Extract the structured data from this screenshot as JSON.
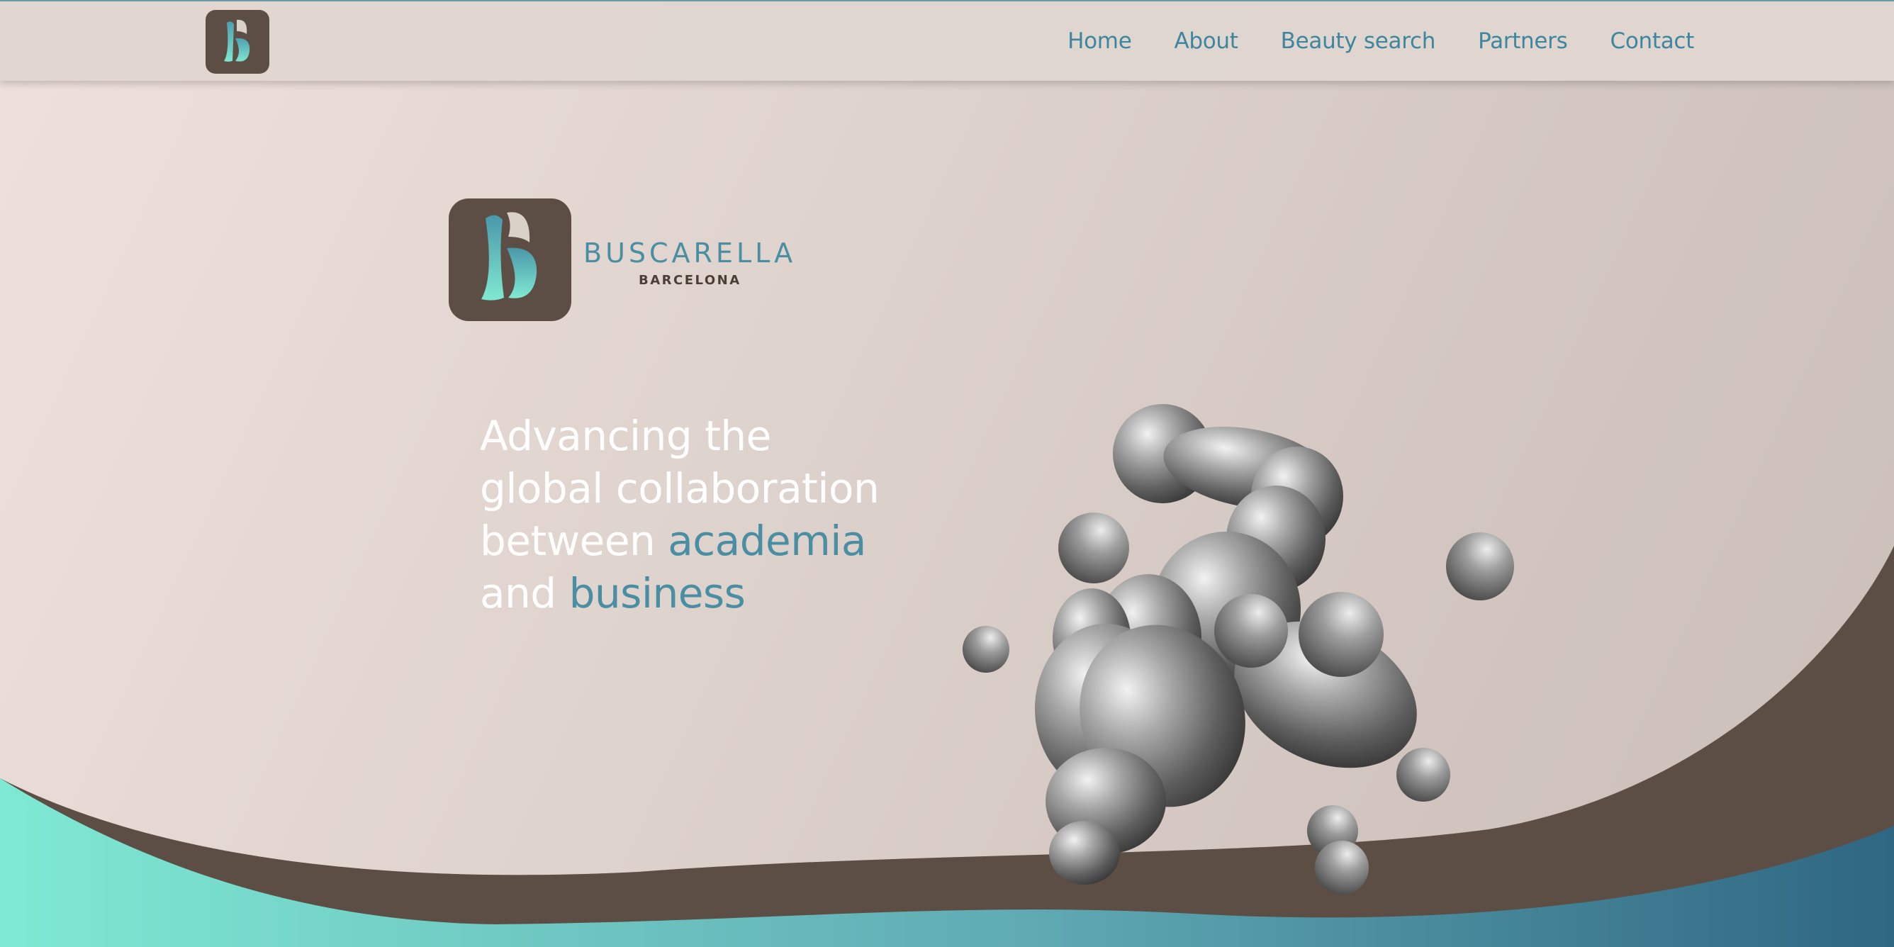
{
  "nav": {
    "logo_alt": "B",
    "links": [
      "Home",
      "About",
      "Beauty search",
      "Partners",
      "Contact"
    ]
  },
  "brand": {
    "name": "BUSCARELLA",
    "city": "BARCELONA"
  },
  "hero": {
    "line1": "Advancing the",
    "line2": "global collaboration",
    "line3_prefix": "between ",
    "line3_accent": "academia",
    "line4_prefix": "and ",
    "line4_accent": "business"
  },
  "colors": {
    "accent": "#4a8ea4",
    "brown": "#5c4d45",
    "teal_light": "#7de8d2",
    "teal_dark": "#2f6a84",
    "background": "#dfd3cd"
  },
  "icons": {
    "logo": "buscarella-b-monogram",
    "blob": "chrome-metaball-sculpture"
  }
}
